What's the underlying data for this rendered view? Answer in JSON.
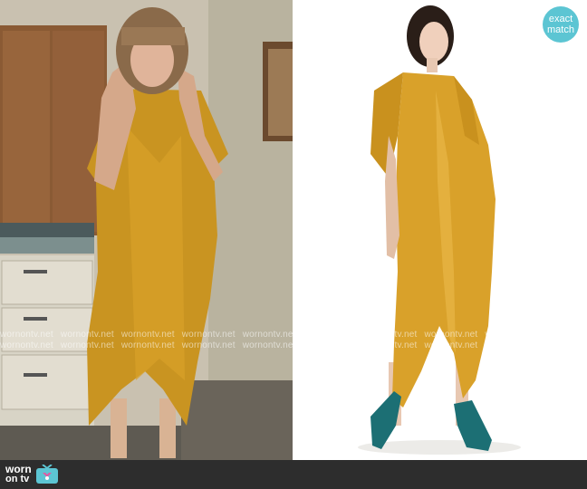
{
  "badge": {
    "line1": "exact",
    "line2": "match"
  },
  "watermark": {
    "text": "wornontv.net"
  },
  "footer": {
    "brand_line1": "worn",
    "brand_line2": "on tv"
  },
  "colors": {
    "dress": "#d9a12a",
    "badge": "#5cc5d3",
    "footer": "#2d2d2d",
    "shoes": "#1c6f74"
  }
}
